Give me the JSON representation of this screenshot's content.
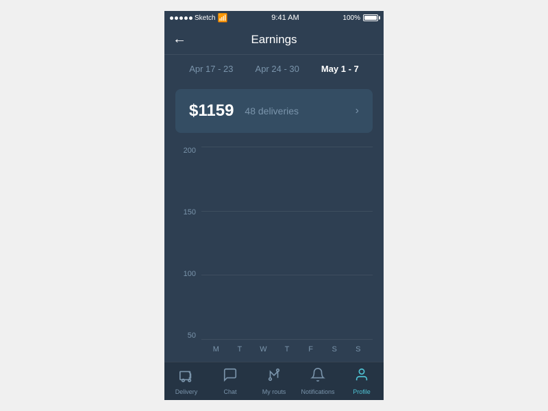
{
  "status_bar": {
    "app_name": "Sketch",
    "time": "9:41 AM",
    "battery": "100%"
  },
  "header": {
    "title": "Earnings",
    "back_label": "←"
  },
  "week_tabs": [
    {
      "label": "Apr 17 - 23",
      "active": false
    },
    {
      "label": "Apr 24 - 30",
      "active": false
    },
    {
      "label": "May 1 - 7",
      "active": true
    }
  ],
  "summary": {
    "amount": "$1159",
    "deliveries": "48 deliveries"
  },
  "chart": {
    "y_labels": [
      "200",
      "150",
      "100",
      "50"
    ],
    "x_labels": [
      "M",
      "T",
      "W",
      "T",
      "F",
      "S",
      "S"
    ],
    "bars": [
      {
        "day": "M",
        "value": 0
      },
      {
        "day": "T",
        "value": 0
      },
      {
        "day": "W",
        "value": 0
      },
      {
        "day": "T",
        "value": 0
      },
      {
        "day": "F",
        "value": 0
      },
      {
        "day": "S",
        "value": 0
      },
      {
        "day": "S",
        "value": 0
      }
    ]
  },
  "bottom_nav": [
    {
      "label": "Delivery",
      "icon": "delivery",
      "active": false
    },
    {
      "label": "Chat",
      "icon": "chat",
      "active": false
    },
    {
      "label": "My routs",
      "icon": "routes",
      "active": false
    },
    {
      "label": "Notifications",
      "icon": "notifications",
      "active": false
    },
    {
      "label": "Profile",
      "icon": "profile",
      "active": true
    }
  ],
  "colors": {
    "accent": "#4fc3d4",
    "bg_dark": "#2e3f52",
    "bg_card": "#344d63",
    "text_muted": "#7a94ab",
    "text_white": "#ffffff"
  }
}
